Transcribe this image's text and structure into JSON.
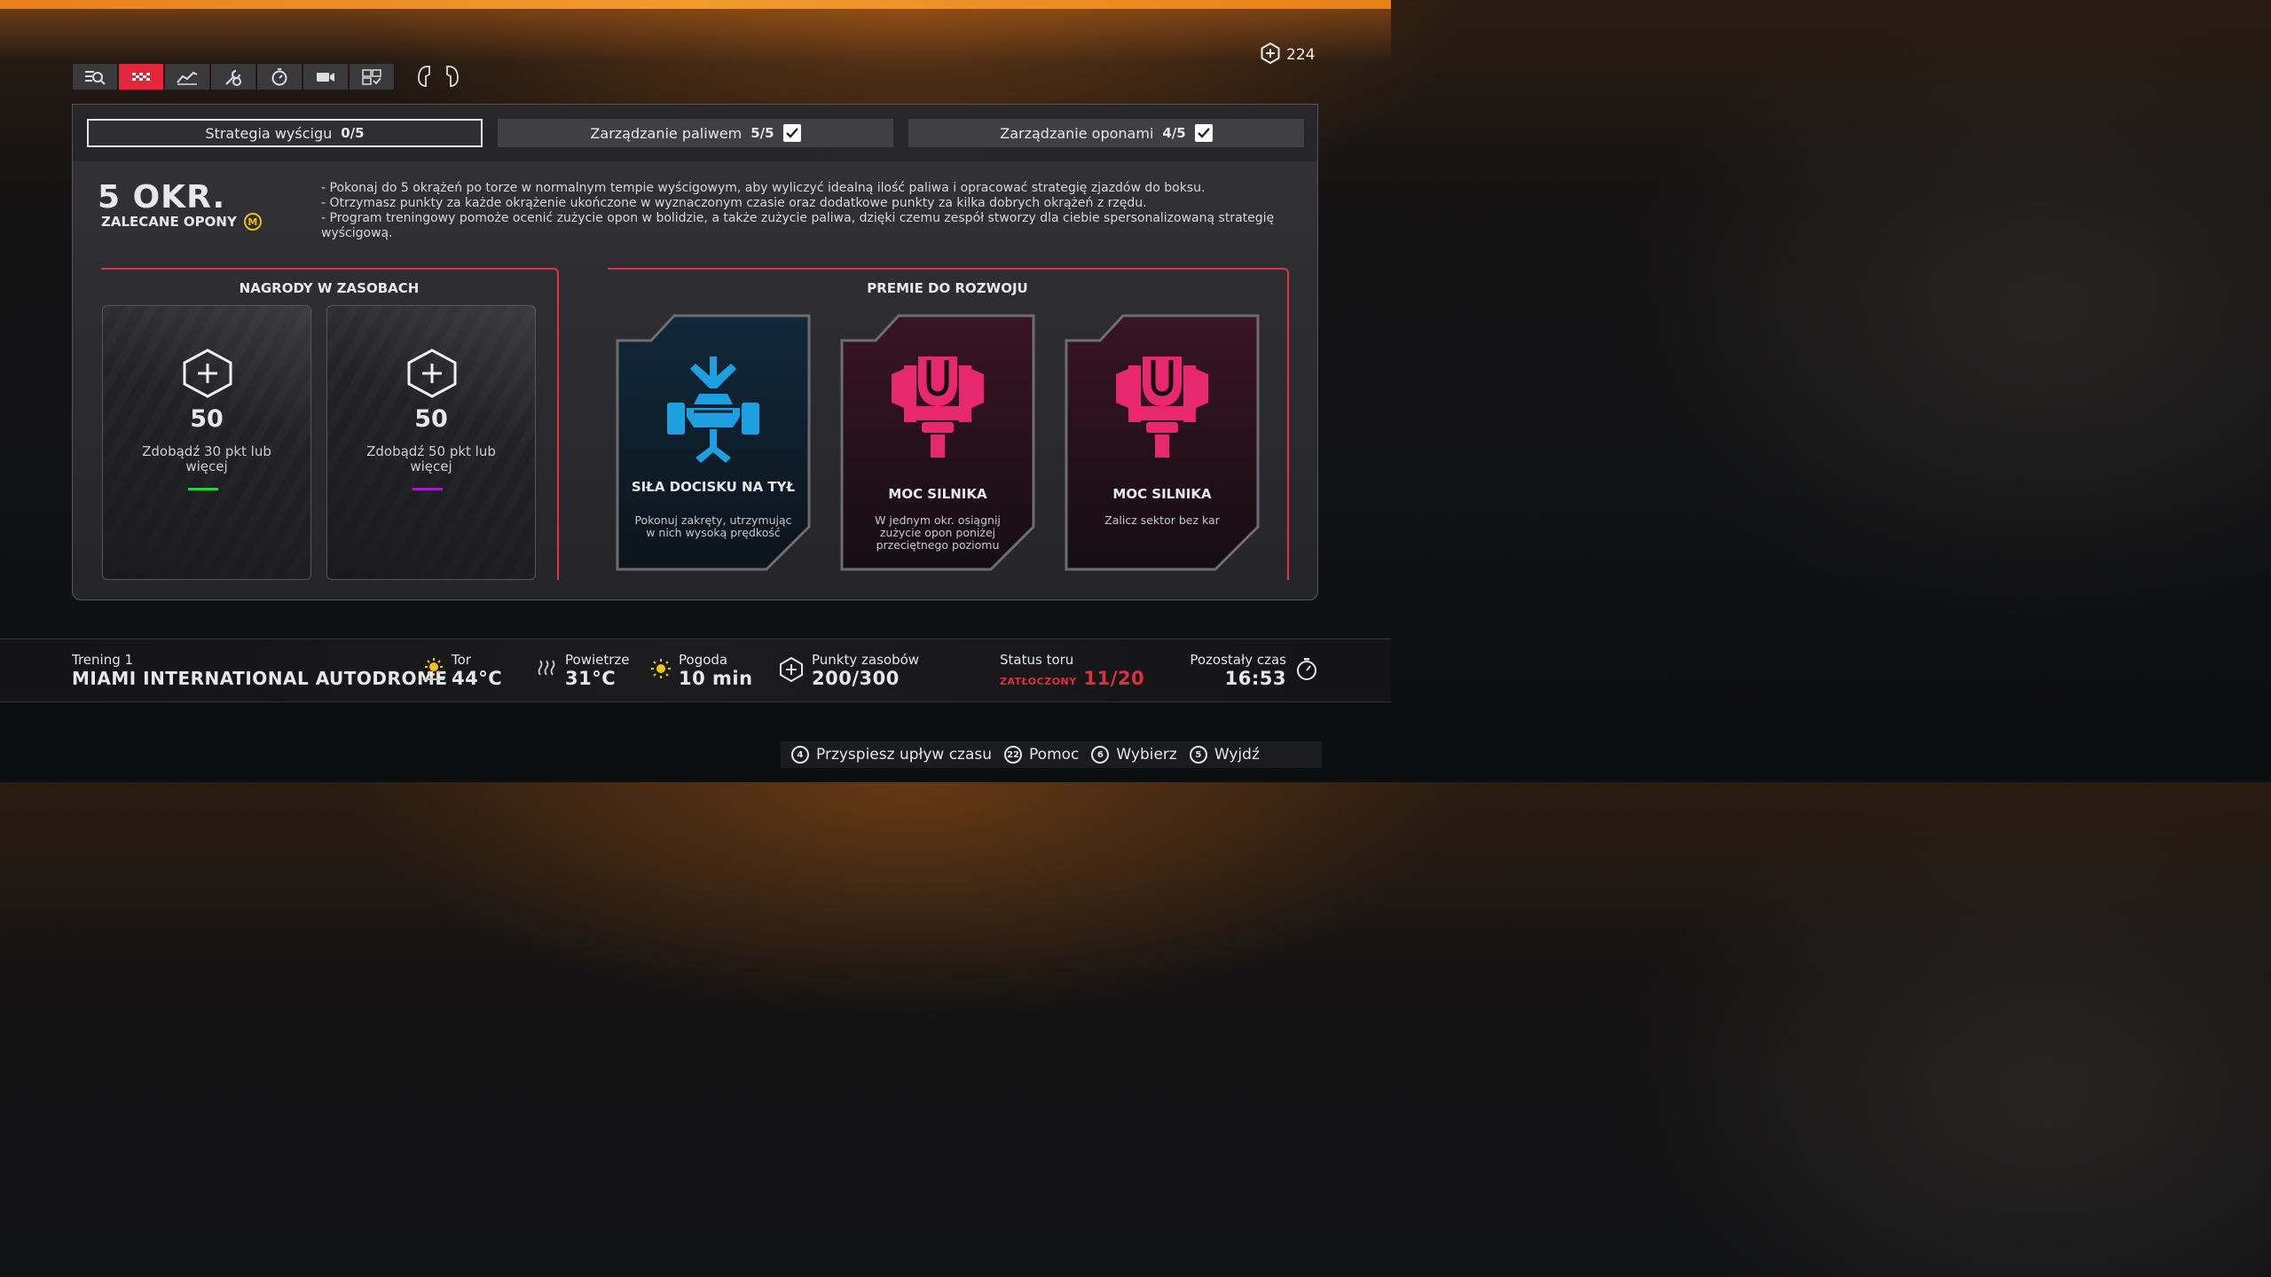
{
  "header": {
    "currency_value": "224",
    "toolbar_icons": [
      "analysis-icon",
      "race-flag-icon",
      "graph-icon",
      "setup-icon",
      "stopwatch-icon",
      "camera-icon",
      "strategy-icon"
    ],
    "bumper_left": "left-bumper-icon",
    "bumper_right": "right-bumper-icon"
  },
  "tabs": [
    {
      "label": "Strategia wyścigu",
      "count": "0/5",
      "completed": false
    },
    {
      "label": "Zarządzanie paliwem",
      "count": "5/5",
      "completed": true
    },
    {
      "label": "Zarządzanie oponami",
      "count": "4/5",
      "completed": true
    }
  ],
  "program": {
    "laps": "5 OKR.",
    "recommended_tyres": "ZALECANE OPONY",
    "tyre_compound": "M",
    "description": [
      "- Pokonaj do 5 okrążeń po torze w normalnym tempie wyścigowym, aby wyliczyć idealną ilość paliwa i opracować strategię zjazdów do boksu.",
      "- Otrzymasz punkty za każde okrążenie ukończone w wyznaczonym czasie oraz dodatkowe punkty za kilka dobrych okrążeń z rzędu.",
      "- Program treningowy pomoże ocenić zużycie opon w bolidzie, a także zużycie paliwa, dzięki czemu zespół stworzy dla ciebie spersonalizowaną strategię wyścigową."
    ]
  },
  "rewards": {
    "title": "NAGRODY W ZASOBACH",
    "items": [
      {
        "amount": "50",
        "condition": "Zdobądź 30 pkt lub więcej",
        "color": "#22d33a"
      },
      {
        "amount": "50",
        "condition": "Zdobądź 50 pkt lub więcej",
        "color": "#a01ec8"
      }
    ]
  },
  "development": {
    "title": "PREMIE DO ROZWOJU",
    "items": [
      {
        "title": "SIŁA DOCISKU NA TYŁ",
        "text": "Pokonuj zakręty, utrzymując w nich wysoką prędkość",
        "color": "#1e9ad6"
      },
      {
        "title": "MOC SILNIKA",
        "text": "W jednym okr. osiągnij zużycie opon poniżej przeciętnego poziomu",
        "color": "#e8286e"
      },
      {
        "title": "MOC SILNIKA",
        "text": "Zalicz sektor bez kar",
        "color": "#e8286e"
      }
    ]
  },
  "session": {
    "name": "Trening 1",
    "track": "MIAMI INTERNATIONAL AUTODROME",
    "track_temp_label": "Tor",
    "track_temp": "44°C",
    "air_temp_label": "Powietrze",
    "air_temp": "31°C",
    "weather_label": "Pogoda",
    "weather_value": "10 min",
    "resource_points_label": "Punkty zasobów",
    "resource_points": "200/300",
    "track_status_label": "Status toru",
    "track_status_text": "ZATŁOCZONY",
    "track_status_value": "11/20",
    "time_left_label": "Pozostały czas",
    "time_left": "16:53"
  },
  "footer": {
    "buttons": [
      {
        "key": "4",
        "label": "Przyspiesz upływ czasu"
      },
      {
        "key": "22",
        "label": "Pomoc"
      },
      {
        "key": "6",
        "label": "Wybierz"
      },
      {
        "key": "5",
        "label": "Wyjdź"
      }
    ]
  }
}
